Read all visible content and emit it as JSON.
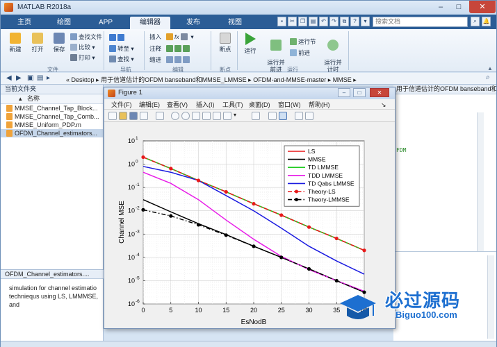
{
  "window": {
    "title": "MATLAB R2018a"
  },
  "tabs": [
    "主页",
    "绘图",
    "APP",
    "编辑器",
    "发布",
    "视图"
  ],
  "active_tab": "编辑器",
  "search": {
    "placeholder": "搜索文档"
  },
  "ribbon": {
    "file_group": {
      "label": "文件",
      "new": "新建",
      "open": "打开",
      "save": "保存",
      "find_files": "查找文件",
      "compare": "比较",
      "print": "打印"
    },
    "nav_group": {
      "label": "导航",
      "goto": "转至",
      "find": "查找"
    },
    "edit_group": {
      "label": "编辑",
      "insert": "插入",
      "fx": "fx",
      "comment": "注释",
      "indent": "缩进"
    },
    "breakpoint_group": {
      "label": "断点",
      "breakpoints": "断点"
    },
    "run_group": {
      "label": "运行",
      "run": "运行",
      "run_advance": "运行并\n前进",
      "run_section": "运行节",
      "advance": "前进",
      "run_time": "运行并\n计时"
    }
  },
  "address": {
    "path": [
      "«",
      "Desktop",
      "用于信道估计的OFDM banseband和MMSE_LMMSE",
      "OFDM-and-MMSE-master",
      "MMSE"
    ]
  },
  "current_folder": {
    "title": "当前文件夹",
    "column": "名称",
    "files": [
      {
        "name": "MMSE_Channel_Tap_Block...",
        "selected": false
      },
      {
        "name": "MMSE_Channel_Tap_Comb...",
        "selected": false
      },
      {
        "name": "MMSE_Uniform_PDP.m",
        "selected": false
      },
      {
        "name": "OFDM_Channel_estimators...",
        "selected": true
      }
    ]
  },
  "details": {
    "title": "OFDM_Channel_estimators....",
    "text": "simulation for channel estimatio techniequs using LS, LMMMSE, and"
  },
  "editor_right": {
    "header": "用于信道估计的OFDM banseband和MMSE_LMMSE\\OF...",
    "snippet": "FDM"
  },
  "figure": {
    "title": "Figure 1",
    "menus": [
      "文件(F)",
      "编辑(E)",
      "查看(V)",
      "插入(I)",
      "工具(T)",
      "桌面(D)",
      "窗口(W)",
      "帮助(H)"
    ]
  },
  "chart_data": {
    "type": "line",
    "xlabel": "EsNodB",
    "ylabel": "Channel MSE",
    "xlim": [
      0,
      40
    ],
    "ylim_log10": [
      -6,
      1
    ],
    "yscale": "log",
    "grid": true,
    "x_ticks": [
      0,
      5,
      10,
      15,
      20,
      25,
      30,
      35,
      40
    ],
    "y_tick_exponents": [
      1,
      0,
      -1,
      -2,
      -3,
      -4,
      -5,
      -6
    ],
    "legend_placement": "top-right",
    "series": [
      {
        "name": "LS",
        "color": "#e8191a",
        "style": "solid",
        "marker": "none",
        "x": [
          0,
          5,
          10,
          15,
          20,
          25,
          30,
          35,
          40
        ],
        "y": [
          2.0,
          0.65,
          0.2,
          0.065,
          0.02,
          0.0065,
          0.002,
          0.00065,
          0.0002
        ]
      },
      {
        "name": "MMSE",
        "color": "#000000",
        "style": "solid",
        "marker": "none",
        "x": [
          0,
          5,
          10,
          15,
          20,
          25,
          30,
          35,
          40
        ],
        "y": [
          0.03,
          0.009,
          0.0028,
          0.00095,
          0.0003,
          0.0001,
          3.2e-05,
          1e-05,
          3.2e-06
        ]
      },
      {
        "name": "TD LMMSE",
        "color": "#22cc22",
        "style": "solid",
        "marker": "none",
        "x": [
          0,
          5,
          10,
          15,
          20,
          25,
          30,
          35,
          40
        ],
        "y": [
          2.0,
          0.65,
          0.2,
          0.065,
          0.02,
          0.0065,
          0.002,
          0.00065,
          0.0002
        ]
      },
      {
        "name": "TDD LMMSE",
        "color": "#e81ce8",
        "style": "solid",
        "marker": "none",
        "x": [
          0,
          5,
          10,
          15,
          20,
          25,
          30,
          35,
          40
        ],
        "y": [
          0.45,
          0.15,
          0.03,
          0.004,
          0.0006,
          0.00011,
          3e-05,
          1e-05,
          3.5e-06
        ]
      },
      {
        "name": "TD Qabs LMMSE",
        "color": "#1a1ae0",
        "style": "solid",
        "marker": "none",
        "x": [
          0,
          5,
          10,
          15,
          20,
          25,
          30,
          35,
          40
        ],
        "y": [
          0.8,
          0.45,
          0.2,
          0.045,
          0.01,
          0.0018,
          0.0003,
          7e-05,
          1.9e-05
        ]
      },
      {
        "name": "Theory-LS",
        "color": "#e8191a",
        "style": "dashdot",
        "marker": "dot",
        "x": [
          0,
          5,
          10,
          15,
          20,
          25,
          30,
          35,
          40
        ],
        "y": [
          2.0,
          0.65,
          0.2,
          0.065,
          0.02,
          0.0065,
          0.002,
          0.00065,
          0.0002
        ]
      },
      {
        "name": "Theory-LMMSE",
        "color": "#000000",
        "style": "dashdot",
        "marker": "dot",
        "x": [
          0,
          5,
          10,
          15,
          20,
          25,
          30,
          35,
          40
        ],
        "y": [
          0.011,
          0.006,
          0.0025,
          0.0009,
          0.0003,
          0.0001,
          3.2e-05,
          1e-05,
          3.2e-06
        ]
      }
    ]
  },
  "watermark": {
    "cn": "必过源码",
    "en": "Biguo100.com"
  }
}
